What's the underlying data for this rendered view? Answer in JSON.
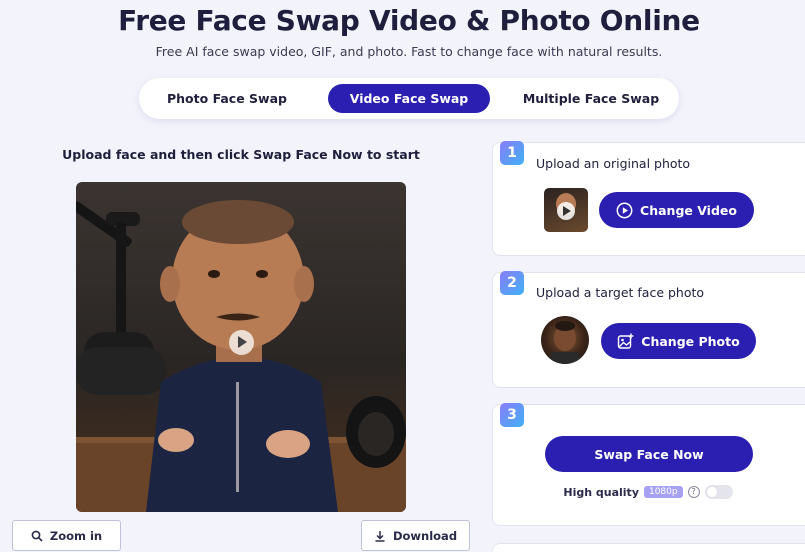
{
  "header": {
    "title": "Free Face Swap Video & Photo Online",
    "subtitle": "Free AI face swap video, GIF, and photo. Fast to change face with natural results."
  },
  "tabs": [
    {
      "label": "Photo Face Swap",
      "active": false
    },
    {
      "label": "Video Face Swap",
      "active": true
    },
    {
      "label": "Multiple Face Swap",
      "active": false
    }
  ],
  "preview": {
    "hint": "Upload face and then click Swap Face Now to start"
  },
  "actions": {
    "zoom_label": "Zoom in",
    "download_label": "Download"
  },
  "steps": [
    {
      "number": "1",
      "title": "Upload an original photo",
      "button": "Change Video"
    },
    {
      "number": "2",
      "title": "Upload a target face photo",
      "button": "Change Photo"
    },
    {
      "number": "3",
      "button": "Swap Face Now"
    }
  ],
  "quality": {
    "label": "High quality",
    "badge": "1080p",
    "help": "?",
    "enabled": false
  },
  "colors": {
    "accent": "#2a1fb0",
    "background": "#f3f4fb",
    "badge_gradient_start": "#8a7cf7",
    "badge_gradient_end": "#3fb2f5"
  }
}
